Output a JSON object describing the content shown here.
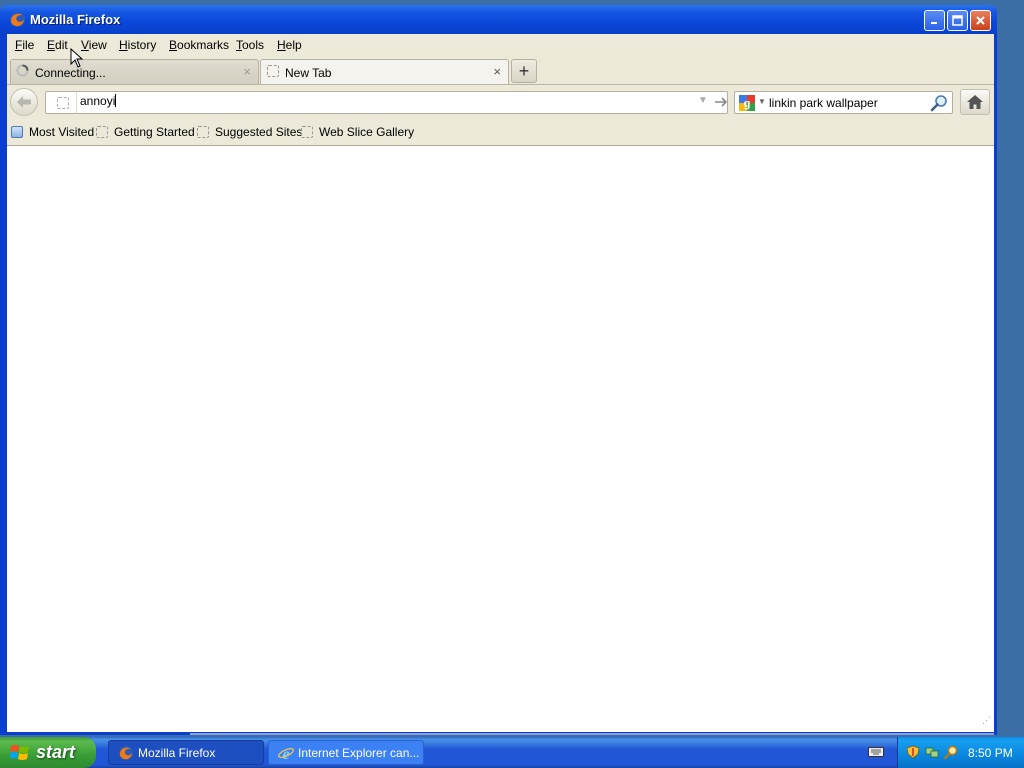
{
  "window": {
    "title": "Mozilla Firefox"
  },
  "menu": [
    "File",
    "Edit",
    "View",
    "History",
    "Bookmarks",
    "Tools",
    "Help"
  ],
  "tabs": [
    {
      "label": "Connecting...",
      "state": "loading"
    },
    {
      "label": "New Tab",
      "state": "active"
    }
  ],
  "new_tab_symbol": "+",
  "close_tab_symbol": "×",
  "urlbar": {
    "value": "annoyi"
  },
  "searchbar": {
    "engine": "Google",
    "value": "linkin park wallpaper"
  },
  "bookmarks": [
    "Most Visited",
    "Getting Started",
    "Suggested Sites",
    "Web Slice Gallery"
  ],
  "taskbar": {
    "start_label": "start",
    "tasks": [
      "Mozilla Firefox",
      "Internet Explorer can..."
    ],
    "clock": "8:50 PM"
  },
  "colors": {
    "titlebar": "#0a46d8",
    "chrome": "#ece9d8",
    "taskbar": "#2157d7",
    "start": "#379d37",
    "tray": "#0a86de"
  },
  "icons": [
    "firefox-icon",
    "minimize-icon",
    "maximize-icon",
    "close-icon",
    "loading-spinner-icon",
    "blank-page-icon",
    "back-arrow-icon",
    "site-identity-icon",
    "dropdown-arrow-icon",
    "go-arrow-icon",
    "google-icon",
    "magnifier-icon",
    "home-icon",
    "most-visited-icon",
    "windows-flag-icon",
    "ie-icon",
    "keyboard-icon",
    "shield-icon",
    "network-icon",
    "search-tray-icon",
    "mouse-pointer-icon"
  ]
}
